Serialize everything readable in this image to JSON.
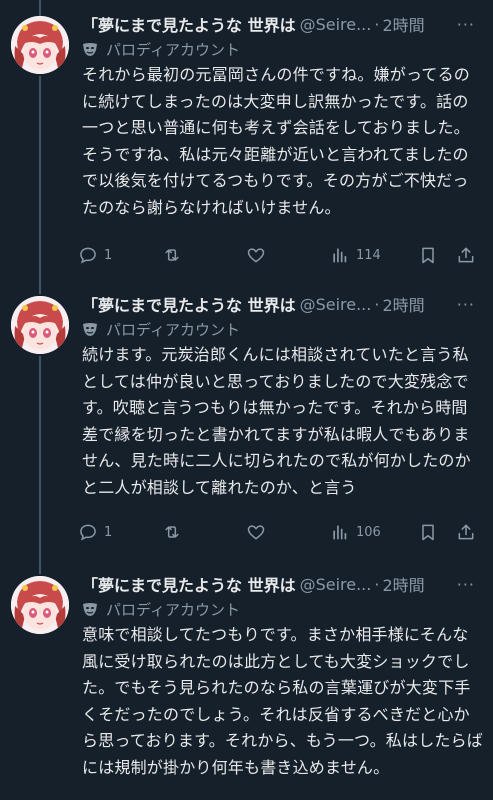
{
  "tweets": [
    {
      "name": "「夢にまで見たような 世界は",
      "handle": "@Seire...",
      "time": "2時間",
      "label": "パロディアカウント",
      "text": "それから最初の元冨岡さんの件ですね。嫌がってるのに続けてしまったのは大変申し訳無かったです。話の一つと思い普通に何も考えず会話をしておりました。そうですね、私は元々距離が近いと言われてましたので以後気を付けてるつもりです。その方がご不快だったのなら謝らなければいけません。",
      "replies": "1",
      "views": "114"
    },
    {
      "name": "「夢にまで見たような 世界は",
      "handle": "@Seire...",
      "time": "2時間",
      "label": "パロディアカウント",
      "text": "続けます。元炭治郎くんには相談されていたと言う私としては仲が良いと思っておりましたので大変残念です。吹聴と言うつもりは無かったです。それから時間差で縁を切ったと書かれてますが私は暇人でもありません、見た時に二人に切られたので私が何かしたのかと二人が相談して離れたのか、と言う",
      "replies": "1",
      "views": "106"
    },
    {
      "name": "「夢にまで見たような 世界は",
      "handle": "@Seire...",
      "time": "2時間",
      "label": "パロディアカウント",
      "text": "意味で相談してたつもりです。まさか相手様にそんな風に受け取られたのは此方としても大変ショックでした。でもそう見られたのなら私の言葉運びが大変下手くそだったのでしょう。それは反省するべきだと心から思っております。それから、もう一つ。私はしたらばには規制が掛かり何年も書き込めません。"
    }
  ],
  "ui": {
    "separator": "·",
    "more": "···"
  },
  "icons": {
    "reply": "reply-icon",
    "retweet": "retweet-icon",
    "like": "heart-icon",
    "views": "views-icon",
    "bookmark": "bookmark-icon",
    "share": "share-icon",
    "label": "parody-mask-icon"
  },
  "colors": {
    "background": "#15202b",
    "text": "#e7e9ea",
    "secondary": "#8b98a5",
    "divider": "#38444d",
    "thread_line": "#425364"
  }
}
